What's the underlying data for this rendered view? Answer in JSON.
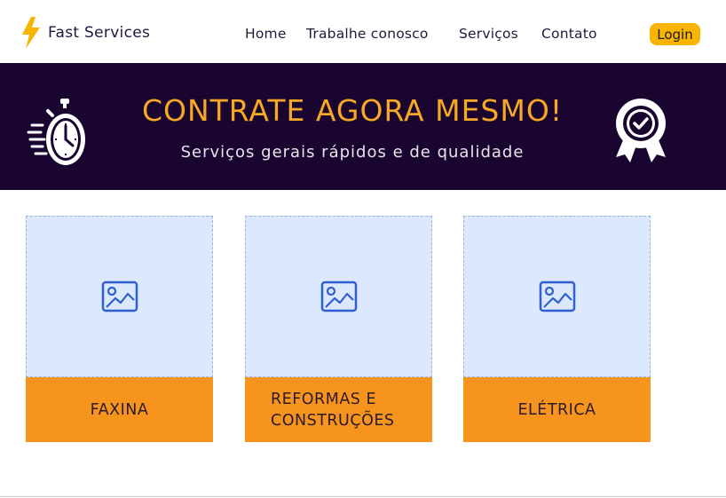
{
  "header": {
    "brand": "Fast Services",
    "nav": [
      "Home",
      "Trabalhe conosco",
      "Serviços",
      "Contato"
    ],
    "login_label": "Login"
  },
  "banner": {
    "title": "CONTRATE AGORA MESMO!",
    "subtitle": "Serviços gerais rápidos e de qualidade"
  },
  "services": [
    {
      "label": "FAXINA",
      "icon": "image-placeholder-icon"
    },
    {
      "label_line1": "REFORMAS E",
      "label_line2": "CONSTRUÇÕES",
      "icon": "image-placeholder-icon"
    },
    {
      "label": "ELÉTRICA",
      "icon": "image-placeholder-icon"
    }
  ],
  "colors": {
    "accent": "#f7b400",
    "banner_bg": "#1a0530",
    "banner_title": "#f7a825",
    "card_label_bg": "#f7941e",
    "card_image_bg": "#dbe8fd",
    "placeholder_icon": "#2f5fd0"
  }
}
